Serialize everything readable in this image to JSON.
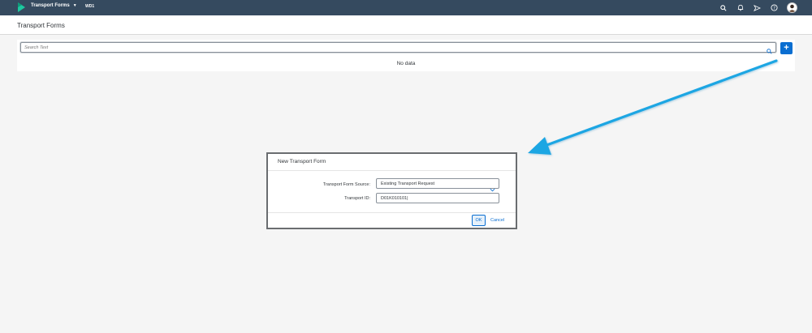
{
  "shell": {
    "app_title": "Transport Forms",
    "system": "WD1",
    "icons": [
      "search-icon",
      "bell-icon",
      "paper-plane-icon",
      "help-icon",
      "avatar"
    ]
  },
  "page": {
    "title": "Transport Forms"
  },
  "search": {
    "placeholder": "Search Text",
    "add_label": "+"
  },
  "list": {
    "empty_text": "No data"
  },
  "dialog": {
    "title": "New Transport Form",
    "source_label": "Transport Form Source:",
    "source_value": "Existing Transport Request",
    "id_label": "Transport ID:",
    "id_value": "D01K010101|",
    "ok_label": "OK",
    "cancel_label": "Cancel"
  },
  "colors": {
    "shell_bg": "#354a5f",
    "accent": "#0a6ed1",
    "arrow": "#1fa3e0"
  }
}
